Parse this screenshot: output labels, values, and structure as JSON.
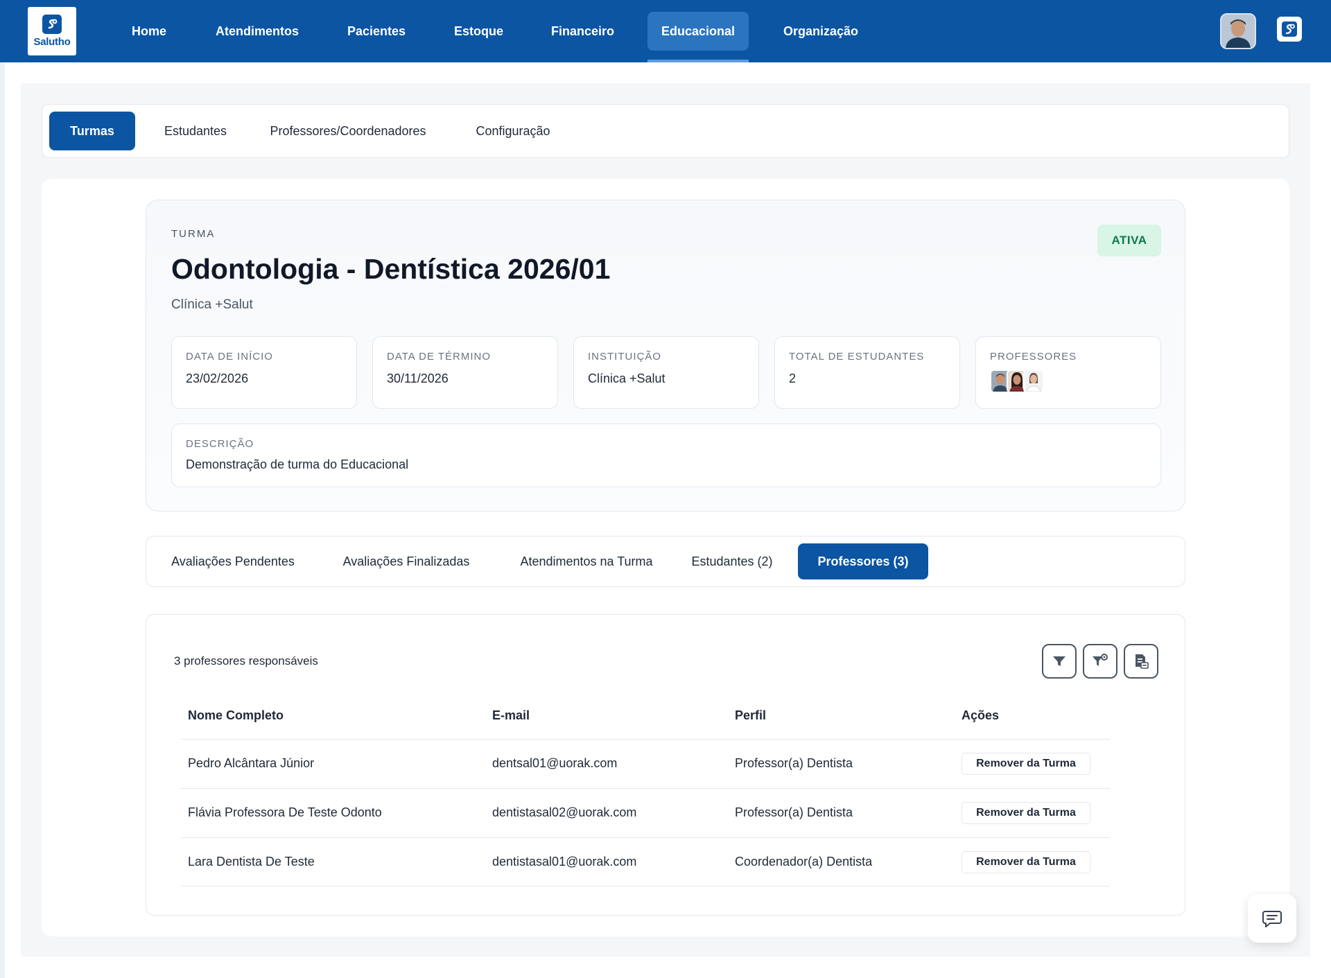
{
  "brand": {
    "name": "Salutho",
    "color": "#0b55a3"
  },
  "topnav": {
    "items": [
      {
        "label": "Home"
      },
      {
        "label": "Atendimentos"
      },
      {
        "label": "Pacientes"
      },
      {
        "label": "Estoque"
      },
      {
        "label": "Financeiro"
      },
      {
        "label": "Educacional",
        "active": true
      },
      {
        "label": "Organização"
      }
    ]
  },
  "subnav": {
    "tabs": [
      {
        "label": "Turmas",
        "active": true
      },
      {
        "label": "Estudantes"
      },
      {
        "label": "Professores/Coordenadores"
      },
      {
        "label": "Configuração"
      }
    ]
  },
  "turma": {
    "section_label": "TURMA",
    "title": "Odontologia - Dentística 2026/01",
    "subtitle": "Clínica +Salut",
    "status": "ATIVA",
    "info": [
      {
        "label": "DATA DE INÍCIO",
        "value": "23/02/2026"
      },
      {
        "label": "DATA DE TÉRMINO",
        "value": "30/11/2026"
      },
      {
        "label": "INSTITUIÇÃO",
        "value": "Clínica +Salut"
      },
      {
        "label": "TOTAL DE ESTUDANTES",
        "value": "2"
      },
      {
        "label": "PROFESSORES"
      }
    ],
    "description_label": "DESCRIÇÃO",
    "description": "Demonstração de turma do Educacional"
  },
  "detail_tabs": [
    {
      "label": "Avaliações Pendentes"
    },
    {
      "label": "Avaliações Finalizadas"
    },
    {
      "label": "Atendimentos na Turma"
    },
    {
      "label": "Estudantes (2)"
    },
    {
      "label": "Professores (3)",
      "active": true
    }
  ],
  "professors_table": {
    "count_text": "3 professores responsáveis",
    "toolbar_icons": [
      "filter-icon",
      "filter-settings-icon",
      "export-icon"
    ],
    "columns": [
      "Nome Completo",
      "E-mail",
      "Perfil",
      "Ações"
    ],
    "rows": [
      {
        "name": "Pedro Alcântara Júnior",
        "email": "dentsal01@uorak.com",
        "profile": "Professor(a) Dentista",
        "action": "Remover da Turma"
      },
      {
        "name": "Flávia Professora De Teste Odonto",
        "email": "dentistasal02@uorak.com",
        "profile": "Professor(a) Dentista",
        "action": "Remover da Turma"
      },
      {
        "name": "Lara Dentista De Teste",
        "email": "dentistasal01@uorak.com",
        "profile": "Coordenador(a) Dentista",
        "action": "Remover da Turma"
      }
    ]
  }
}
